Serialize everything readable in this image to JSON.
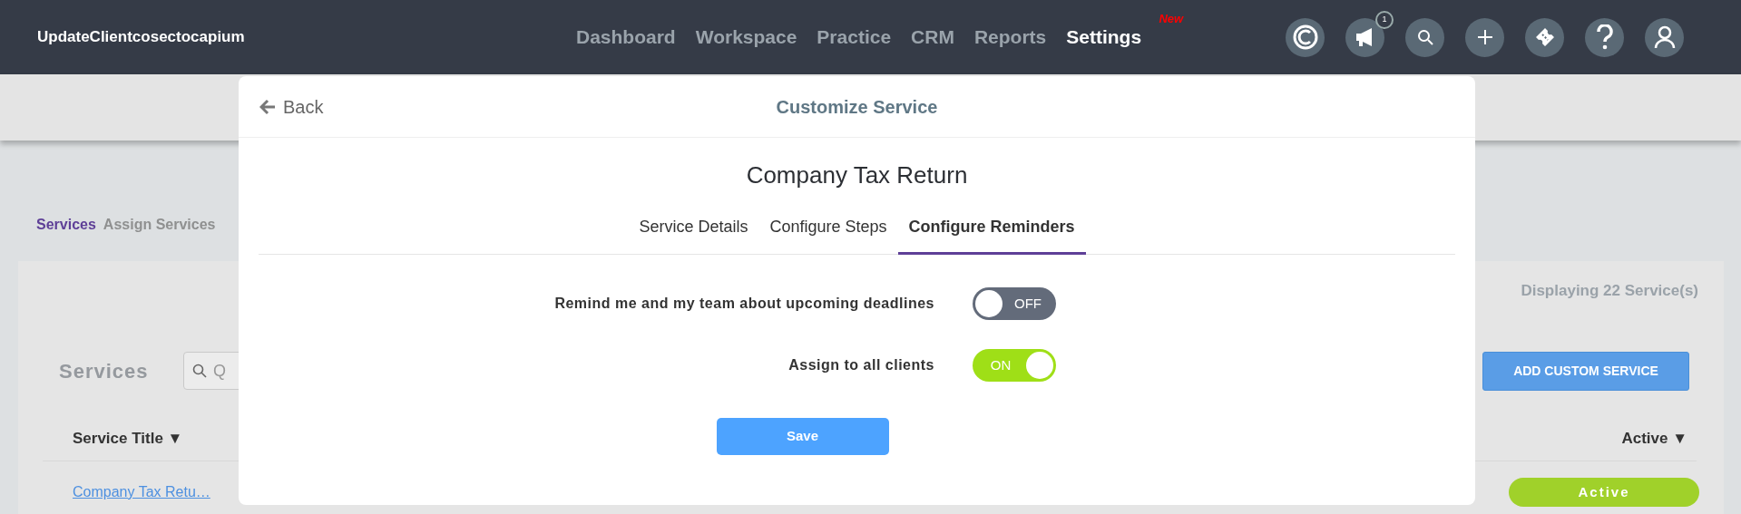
{
  "navbar": {
    "brand": "UpdateClientcosectocapium",
    "items": [
      {
        "label": "Dashboard",
        "selected": false
      },
      {
        "label": "Workspace",
        "selected": false
      },
      {
        "label": "Practice",
        "selected": false
      },
      {
        "label": "CRM",
        "selected": false
      },
      {
        "label": "Reports",
        "selected": false
      },
      {
        "label": "Settings",
        "selected": true,
        "badge": "New"
      }
    ],
    "icons": [
      {
        "kind": "copyright"
      },
      {
        "kind": "megaphone",
        "count": "1"
      },
      {
        "kind": "search"
      },
      {
        "kind": "plus"
      },
      {
        "kind": "ticket"
      },
      {
        "kind": "help"
      },
      {
        "kind": "user"
      }
    ]
  },
  "page": {
    "subtabs": [
      {
        "label": "Services",
        "selected": true
      },
      {
        "label": "Assign Services",
        "selected": false
      }
    ],
    "count_text": "Displaying 22 Service(s)",
    "section_title": "Services",
    "search": {
      "placeholder": "Q"
    },
    "add_button": "ADD CUSTOM SERVICE",
    "columns": [
      "Service Title ▼",
      "Active ▼"
    ],
    "rows": [
      {
        "title": "Company Tax Retu…",
        "status": "Active"
      }
    ]
  },
  "modal": {
    "back": "Back",
    "title": "Customize Service",
    "service_name": "Company Tax Return",
    "tabs": [
      {
        "label": "Service Details",
        "selected": false
      },
      {
        "label": "Configure Steps",
        "selected": false
      },
      {
        "label": "Configure Reminders",
        "selected": true
      }
    ],
    "settings": [
      {
        "label": "Remind me and my team about upcoming deadlines",
        "on": false,
        "state_text": "OFF"
      },
      {
        "label": "Assign to all clients",
        "on": true,
        "state_text": "ON"
      }
    ],
    "save": "Save"
  }
}
